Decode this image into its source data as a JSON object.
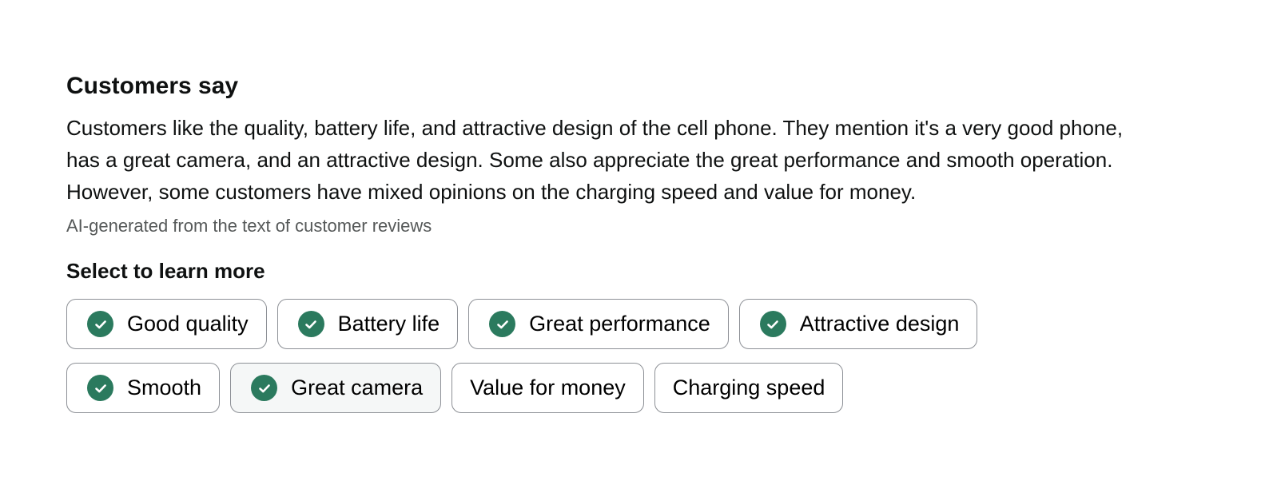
{
  "customers_say": {
    "heading": "Customers say",
    "summary": "Customers like the quality, battery life, and attractive design of the cell phone. They mention it's a very good phone, has a great camera, and an attractive design. Some also appreciate the great performance and smooth operation. However, some customers have mixed opinions on the charging speed and value for money.",
    "disclaimer": "AI-generated from the text of customer reviews"
  },
  "learn_more": {
    "heading": "Select to learn more",
    "chips": [
      {
        "label": "Good quality",
        "sentiment": "positive",
        "icon": "check-circle-icon"
      },
      {
        "label": "Battery life",
        "sentiment": "positive",
        "icon": "check-circle-icon"
      },
      {
        "label": "Great performance",
        "sentiment": "positive",
        "icon": "check-circle-icon"
      },
      {
        "label": "Attractive design",
        "sentiment": "positive",
        "icon": "check-circle-icon"
      },
      {
        "label": "Smooth",
        "sentiment": "positive",
        "icon": "check-circle-icon"
      },
      {
        "label": "Great camera",
        "sentiment": "positive",
        "icon": "check-circle-icon"
      },
      {
        "label": "Value for money",
        "sentiment": "mixed"
      },
      {
        "label": "Charging speed",
        "sentiment": "mixed"
      }
    ]
  },
  "colors": {
    "positive_icon": "#2b7a5e",
    "chip_border": "#8d9096",
    "secondary_text": "#565959"
  }
}
